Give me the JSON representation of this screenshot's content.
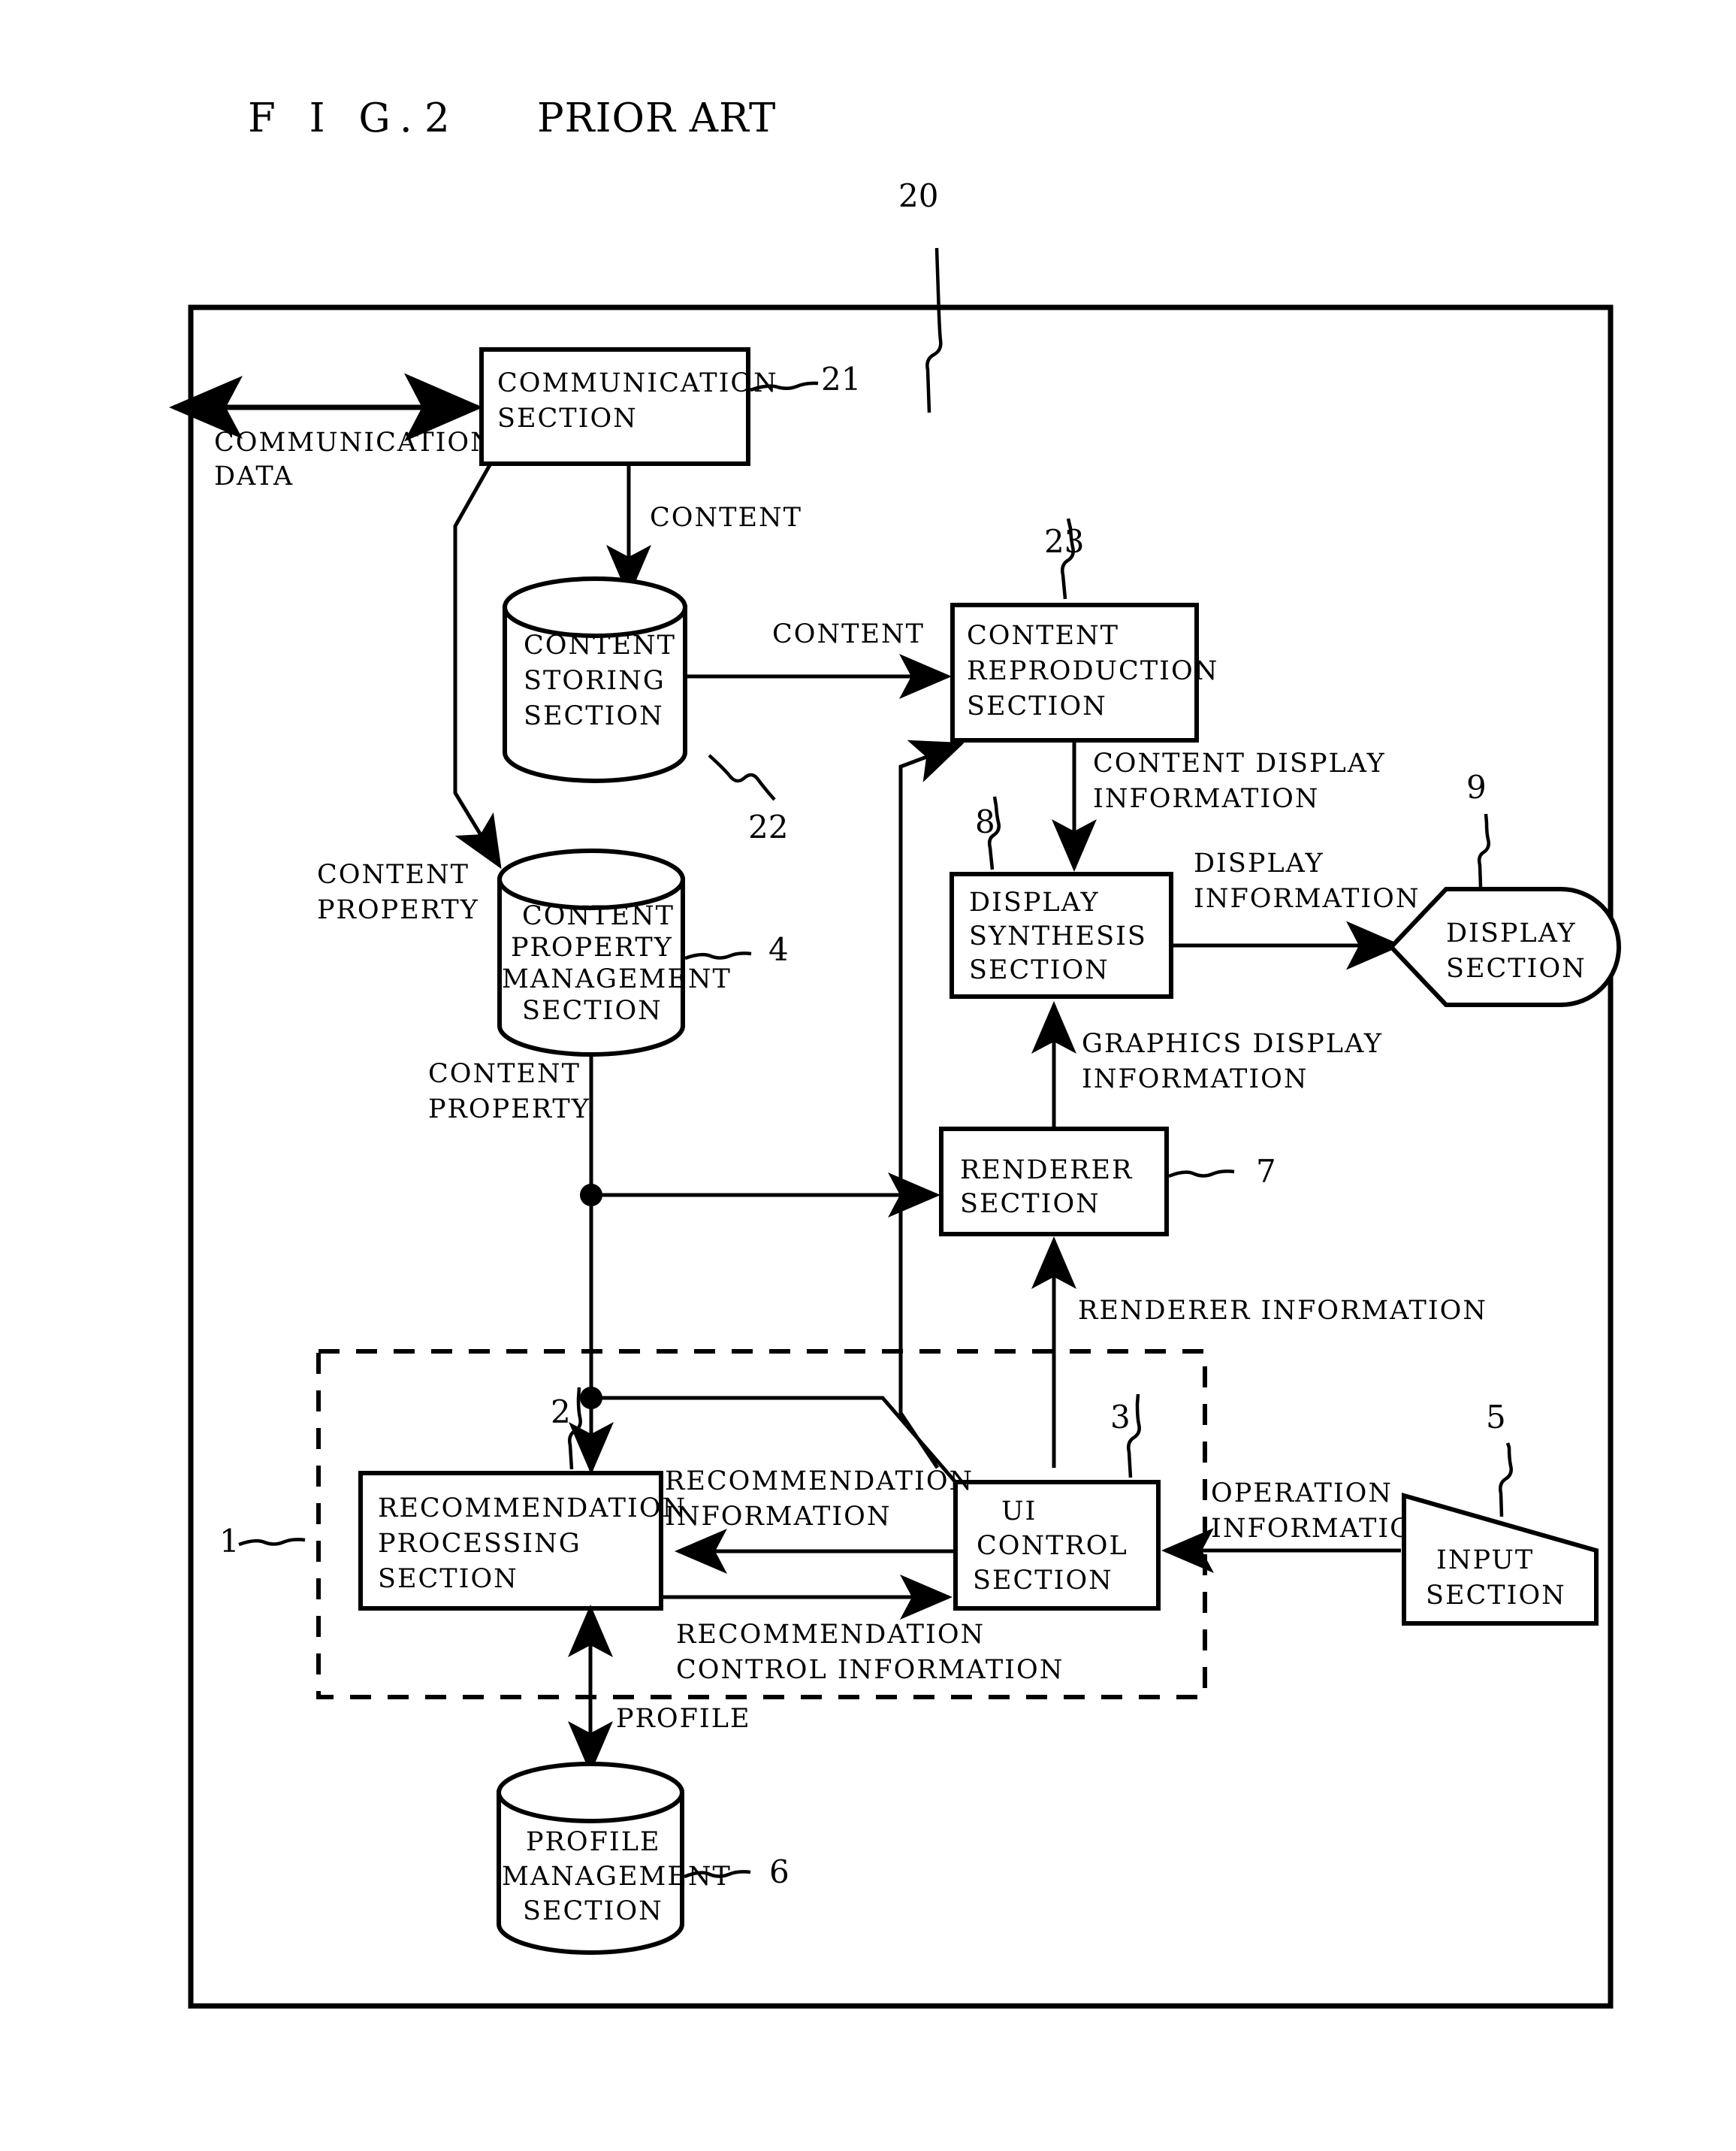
{
  "figure": {
    "label_fig": "F I G.",
    "label_num": "2",
    "label_prior_art": "PRIOR ART"
  },
  "reference_numerals": {
    "system": "20",
    "communication_section": "21",
    "content_storing_section": "22",
    "content_reproduction_section": "23",
    "content_property_management_section": "4",
    "display_synthesis_section": "8",
    "display_section": "9",
    "renderer_section": "7",
    "recommendation_processing_section": "2",
    "ui_control_section": "3",
    "input_section": "5",
    "profile_management_section": "6",
    "recommendation_subsystem": "1"
  },
  "nodes": {
    "communication_section": {
      "lines": [
        "COMMUNICATION",
        "SECTION"
      ],
      "shape": "rect"
    },
    "content_storing_section": {
      "lines": [
        "CONTENT",
        "STORING",
        "SECTION"
      ],
      "shape": "cylinder"
    },
    "content_property_management_section": {
      "lines": [
        "CONTENT",
        "PROPERTY",
        "MANAGEMENT",
        "SECTION"
      ],
      "shape": "cylinder"
    },
    "content_reproduction_section": {
      "lines": [
        "CONTENT",
        "REPRODUCTION",
        "SECTION"
      ],
      "shape": "rect"
    },
    "display_synthesis_section": {
      "lines": [
        "DISPLAY",
        "SYNTHESIS",
        "SECTION"
      ],
      "shape": "rect"
    },
    "display_section": {
      "lines": [
        "DISPLAY",
        "SECTION"
      ],
      "shape": "pointed-rounded"
    },
    "renderer_section": {
      "lines": [
        "RENDERER",
        "SECTION"
      ],
      "shape": "rect"
    },
    "recommendation_processing_section": {
      "lines": [
        "RECOMMENDATION",
        "PROCESSING",
        "SECTION"
      ],
      "shape": "rect"
    },
    "ui_control_section": {
      "lines": [
        "UI",
        "CONTROL",
        "SECTION"
      ],
      "shape": "rect"
    },
    "input_section": {
      "lines": [
        "INPUT",
        "SECTION"
      ],
      "shape": "trapezoid"
    },
    "profile_management_section": {
      "lines": [
        "PROFILE",
        "MANAGEMENT",
        "SECTION"
      ],
      "shape": "cylinder"
    }
  },
  "edge_labels": {
    "communication_data": [
      "COMMUNICATION",
      "DATA"
    ],
    "content_from_comm": [
      "CONTENT"
    ],
    "content_to_reproduction": [
      "CONTENT"
    ],
    "content_property_to_mgmt": [
      "CONTENT",
      "PROPERTY"
    ],
    "content_property_from_mgmt": [
      "CONTENT",
      "PROPERTY"
    ],
    "content_display_information": [
      "CONTENT DISPLAY",
      "INFORMATION"
    ],
    "display_information": [
      "DISPLAY",
      "INFORMATION"
    ],
    "graphics_display_information": [
      "GRAPHICS DISPLAY",
      "INFORMATION"
    ],
    "renderer_information": [
      "RENDERER INFORMATION"
    ],
    "recommendation_information": [
      "RECOMMENDATION",
      "INFORMATION"
    ],
    "recommendation_control_information": [
      "RECOMMENDATION",
      "CONTROL INFORMATION"
    ],
    "operation_information": [
      "OPERATION",
      "INFORMATION"
    ],
    "profile": [
      "PROFILE"
    ]
  }
}
